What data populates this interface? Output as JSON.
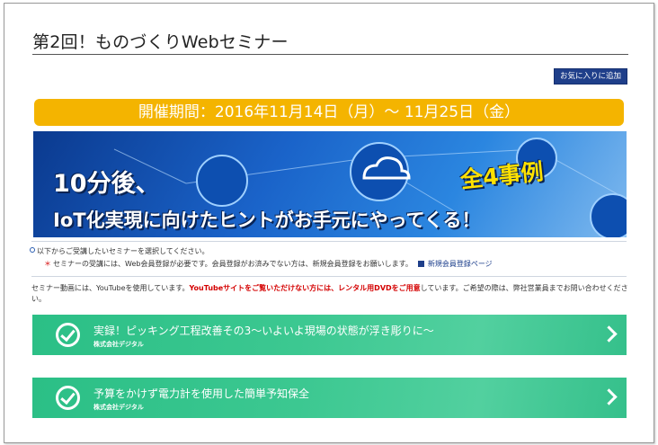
{
  "page": {
    "title": "第2回！ものづくりWebセミナー",
    "favorite_button": "お気に入りに追加"
  },
  "event": {
    "period": "開催期間：2016年11月14日（月）～ 11月25日（金）"
  },
  "banner": {
    "line1": "10分後、",
    "line2": "IoT化実現に向けたヒントがお手元にやってくる！",
    "badge": "全4事例"
  },
  "notices": {
    "select_prompt": "以下からご受講したいセミナーを選択してください。",
    "registration_note_star": "＊",
    "registration_note": "セミナーの受講には、Web会員登録が必要です。会員登録がお済みでない方は、新規会員登録をお願いします。",
    "registration_link": "新規会員登録ページ",
    "youtube_notice_part1": "セミナー動画には、YouTubeを使用しています。",
    "youtube_notice_red": "YouTubeサイトをご覧いただけない方には、レンタル用DVDをご用意",
    "youtube_notice_part2": "しています。ご希望の際は、弊社営業員までお問い合わせください。"
  },
  "seminars": [
    {
      "title": "実録！ピッキング工程改善その3～いよいよ現場の状態が浮き彫りに～",
      "company": "株式会社デジタル"
    },
    {
      "title": "予算をかけず電力計を使用した簡単予知保全",
      "company": "株式会社デジタル"
    }
  ],
  "colors": {
    "accent_blue": "#1f3f8a",
    "period_orange": "#f4b400",
    "card_green": "#3cc891",
    "notice_red": "#d40000"
  }
}
